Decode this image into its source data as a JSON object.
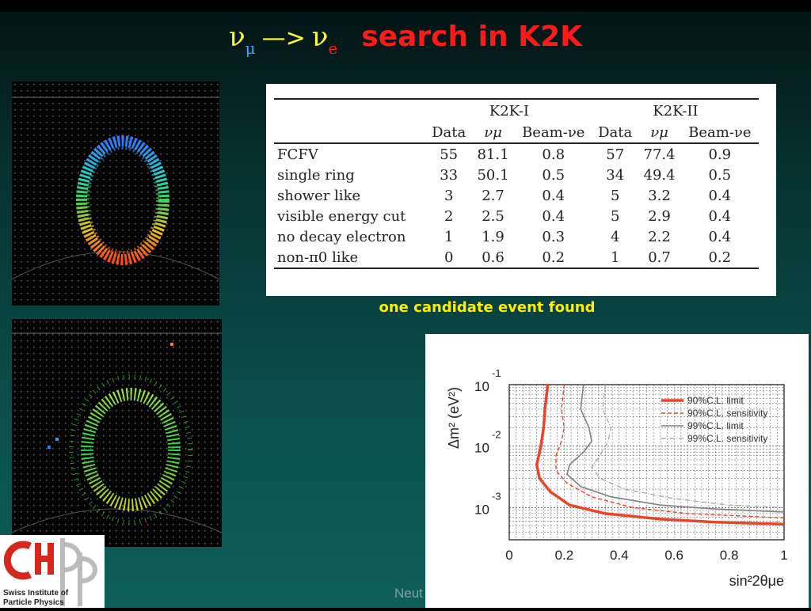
{
  "title": {
    "nu": "ν",
    "mu": "μ",
    "arrow": "—>",
    "e": "e",
    "text": "search in K2K"
  },
  "table": {
    "groups": [
      "K2K-I",
      "K2K-II"
    ],
    "columns": [
      "Data",
      "νμ",
      "Beam-νe",
      "Data",
      "νμ",
      "Beam-νe"
    ],
    "rows": [
      {
        "label": "FCFV",
        "values": [
          "55",
          "81.1",
          "0.8",
          "57",
          "77.4",
          "0.9"
        ]
      },
      {
        "label": "single ring",
        "values": [
          "33",
          "50.1",
          "0.5",
          "34",
          "49.4",
          "0.5"
        ]
      },
      {
        "label": "shower like",
        "values": [
          "3",
          "2.7",
          "0.4",
          "5",
          "3.2",
          "0.4"
        ]
      },
      {
        "label": "visible energy cut",
        "values": [
          "2",
          "2.5",
          "0.4",
          "5",
          "2.9",
          "0.4"
        ]
      },
      {
        "label": "no decay electron",
        "values": [
          "1",
          "1.9",
          "0.3",
          "4",
          "2.2",
          "0.4"
        ]
      },
      {
        "label": "non-π0 like",
        "values": [
          "0",
          "0.6",
          "0.2",
          "1",
          "0.7",
          "0.2"
        ]
      }
    ]
  },
  "caption": "one candidate event found",
  "chart_data": {
    "type": "line",
    "xlabel": "sin²2θμe",
    "ylabel": "Δm² (eV²)",
    "xlim": [
      0,
      1
    ],
    "ylim": [
      0.0003,
      0.1
    ],
    "log_y": true,
    "x_ticks": [
      "0",
      "0.2",
      "0.4",
      "0.6",
      "0.8",
      "1"
    ],
    "y_ticks": [
      {
        "base": "10",
        "exp": "-1"
      },
      {
        "base": "10",
        "exp": "-2"
      },
      {
        "base": "10",
        "exp": "-3"
      }
    ],
    "grid": true,
    "legend_position": "top-right",
    "series": [
      {
        "name": "90%C.L. limit",
        "color": "#e8462a",
        "style": "solid-thick",
        "points": [
          [
            0.14,
            0.1
          ],
          [
            0.13,
            0.04
          ],
          [
            0.125,
            0.02
          ],
          [
            0.115,
            0.01
          ],
          [
            0.1,
            0.005
          ],
          [
            0.11,
            0.003
          ],
          [
            0.15,
            0.0018
          ],
          [
            0.22,
            0.0011
          ],
          [
            0.35,
            0.0008
          ],
          [
            0.55,
            0.00065
          ],
          [
            0.75,
            0.00058
          ],
          [
            1.0,
            0.00054
          ]
        ]
      },
      {
        "name": "90%C.L. sensitivity",
        "color": "#e8462a",
        "style": "dashed",
        "points": [
          [
            0.2,
            0.1
          ],
          [
            0.19,
            0.04
          ],
          [
            0.2,
            0.02
          ],
          [
            0.19,
            0.012
          ],
          [
            0.17,
            0.007
          ],
          [
            0.17,
            0.004
          ],
          [
            0.21,
            0.0025
          ],
          [
            0.3,
            0.0015
          ],
          [
            0.45,
            0.001
          ],
          [
            0.65,
            0.0008
          ],
          [
            1.0,
            0.00068
          ]
        ]
      },
      {
        "name": "99%C.L. limit",
        "color": "#808080",
        "style": "solid",
        "points": [
          [
            0.27,
            0.1
          ],
          [
            0.26,
            0.04
          ],
          [
            0.29,
            0.02
          ],
          [
            0.3,
            0.012
          ],
          [
            0.27,
            0.008
          ],
          [
            0.22,
            0.005
          ],
          [
            0.21,
            0.0035
          ],
          [
            0.26,
            0.0022
          ],
          [
            0.37,
            0.0015
          ],
          [
            0.55,
            0.0011
          ],
          [
            0.75,
            0.00095
          ],
          [
            1.0,
            0.00085
          ]
        ]
      },
      {
        "name": "99%C.L. sensitivity",
        "color": "#a0a0a0",
        "style": "dash-dot",
        "points": [
          [
            0.35,
            0.1
          ],
          [
            0.34,
            0.04
          ],
          [
            0.37,
            0.02
          ],
          [
            0.36,
            0.012
          ],
          [
            0.33,
            0.007
          ],
          [
            0.3,
            0.0045
          ],
          [
            0.33,
            0.003
          ],
          [
            0.42,
            0.002
          ],
          [
            0.6,
            0.0014
          ],
          [
            0.8,
            0.0011
          ],
          [
            1.0,
            0.001
          ]
        ]
      }
    ]
  },
  "logo": {
    "line1": "Swiss Institute of",
    "line2": "Particle Physics"
  },
  "footer": "Neut"
}
